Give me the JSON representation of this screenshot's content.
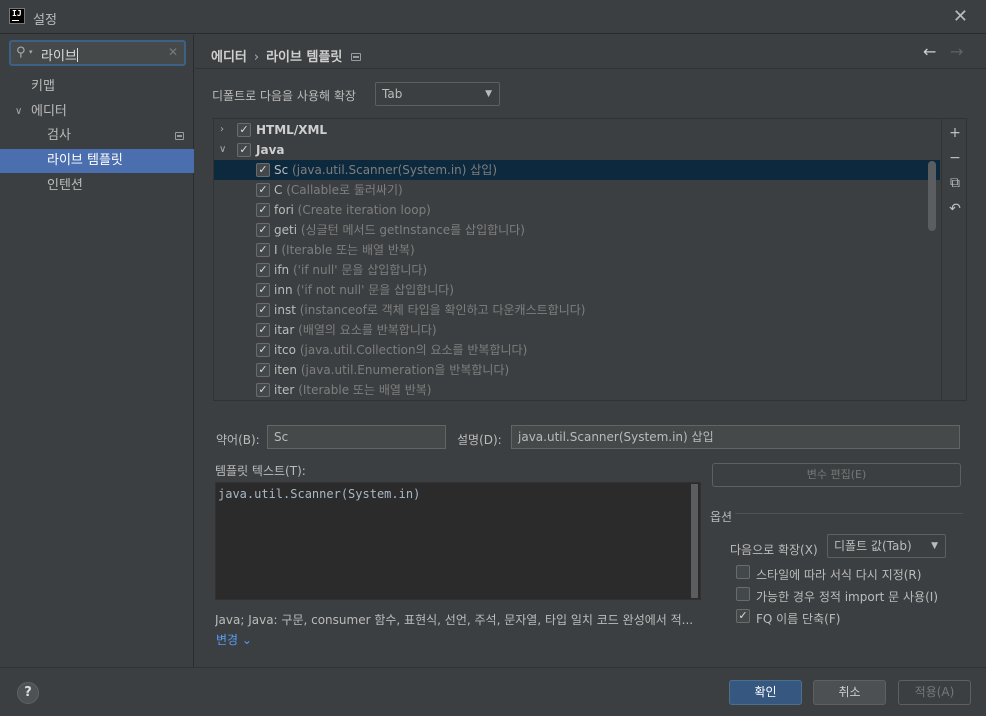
{
  "window": {
    "app_icon": "IJ",
    "title": "설정",
    "close_icon": "✕"
  },
  "sidebar": {
    "search": {
      "value": "라이브"
    },
    "items": [
      {
        "label": "키맵"
      },
      {
        "label": "에디터"
      },
      {
        "label": "검사"
      },
      {
        "label": "라이브 템플릿"
      },
      {
        "label": "인텐션"
      }
    ]
  },
  "header": {
    "crumb_parent": "에디터",
    "crumb_separator": "›",
    "crumb_current": "라이브 템플릿",
    "back_icon": "←",
    "forward_icon": "→"
  },
  "expand": {
    "label": "디폴트로 다음을 사용해 확장",
    "value": "Tab"
  },
  "tree": {
    "groups": [
      {
        "name": "HTML/XML",
        "checked": true,
        "expanded": false
      },
      {
        "name": "Java",
        "checked": true,
        "expanded": true
      }
    ],
    "templates": [
      {
        "abbr": "Sc",
        "desc": "(java.util.Scanner(System.in) 삽입)"
      },
      {
        "abbr": "C",
        "desc": "(Callable로 둘러싸기)"
      },
      {
        "abbr": "fori",
        "desc": "(Create iteration loop)"
      },
      {
        "abbr": "geti",
        "desc": "(싱글턴 메서드 getInstance를 삽입합니다)"
      },
      {
        "abbr": "I",
        "desc": "(Iterable 또는 배열 반복)"
      },
      {
        "abbr": "ifn",
        "desc": "('if null' 문을 삽입합니다)"
      },
      {
        "abbr": "inn",
        "desc": "('if not null' 문을 삽입합니다)"
      },
      {
        "abbr": "inst",
        "desc": "(instanceof로 객체 타입을 확인하고 다운캐스트합니다)"
      },
      {
        "abbr": "itar",
        "desc": "(배열의 요소를 반복합니다)"
      },
      {
        "abbr": "itco",
        "desc": "(java.util.Collection의 요소를 반복합니다)"
      },
      {
        "abbr": "iten",
        "desc": "(java.util.Enumeration을 반복합니다)"
      },
      {
        "abbr": "iter",
        "desc": "(Iterable 또는 배열 반복)"
      }
    ],
    "toolbar": {
      "add": "+",
      "remove": "−",
      "copy": "⧉",
      "restore": "↶"
    }
  },
  "form": {
    "abbr_label": "약어(B):",
    "abbr_value": "Sc",
    "desc_label": "설명(D):",
    "desc_value": "java.util.Scanner(System.in) 삽입",
    "template_label": "템플릿 텍스트(T):",
    "template_text": "java.util.Scanner(System.in)",
    "edit_vars": "변수 편집(E)",
    "options_title": "옵션",
    "expand_with_label": "다음으로 확장(X)",
    "expand_with_value": "디폴트 값(Tab)",
    "reformat_label": "스타일에 따라 서식 다시 지정(R)",
    "static_import_label": "가능한 경우 정적 import 문 사용(I)",
    "shorten_fq_label": "FQ 이름 단축(F)",
    "context_text": "Java; Java: 구문, consumer 함수, 표현식, 선언, 주석, 문자열, 타입 일치 코드 완성에서 적...",
    "change_link": "변경 ⌄"
  },
  "footer": {
    "help": "?",
    "ok": "확인",
    "cancel": "취소",
    "apply": "적용(A)"
  }
}
